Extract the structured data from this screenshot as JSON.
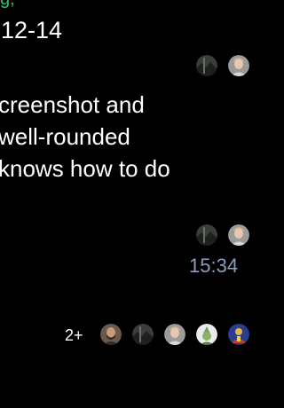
{
  "header": {
    "date_fragment": "12-14"
  },
  "message": {
    "lines": [
      "creenshot and",
      " well-rounded",
      "knows how to do"
    ],
    "time": "15:34"
  },
  "read_receipts": {
    "first_group": [
      "avatar-dark-landscape",
      "avatar-person-light"
    ],
    "second_group": [
      "avatar-dark-landscape",
      "avatar-person-light"
    ]
  },
  "participants": {
    "more_count": "2+",
    "avatars": [
      "avatar-bearded-man",
      "avatar-dark-landscape",
      "avatar-person-light",
      "avatar-alien-green",
      "avatar-colorful-figure"
    ]
  },
  "colors": {
    "background": "#000000",
    "text": "#ffffff",
    "timestamp": "#8e9db8",
    "accent_green": "#2fbf6a"
  }
}
